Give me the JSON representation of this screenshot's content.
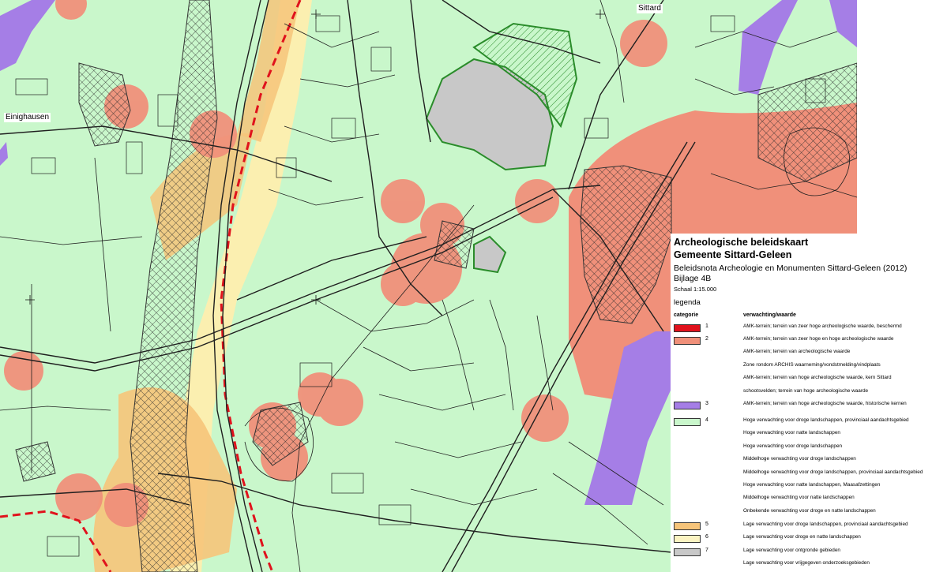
{
  "map": {
    "place_labels": [
      "Sittard",
      "Einighausen"
    ],
    "colors": {
      "green": "#c9f7cb",
      "salmon": "#f0907a",
      "purple": "#a57ee6",
      "orange": "#f6c47a",
      "yellow": "#fbefb0",
      "grey": "#c8c8c8",
      "red": "#e0121c",
      "darkgreen": "#2a8c2a",
      "road": "#1f1f1f"
    }
  },
  "legend": {
    "title1": "Archeologische beleidskaart",
    "title2": "Gemeente Sittard-Geleen",
    "subtitle": "Beleidsnota Archeologie en Monumenten Sittard-Geleen (2012)",
    "annex": "Bijlage 4B",
    "scale": "Schaal 1:15.000",
    "legend_label": "legenda",
    "col_category": "categorie",
    "col_value": "verwachting/waarde",
    "rows": [
      {
        "num": "1",
        "color": "#e0121c",
        "text": "AMK-terrein; terrein van zeer hoge archeologische waarde, beschermd"
      },
      {
        "num": "2",
        "color": "#f0907a",
        "text": "AMK-terrein; terrein van zeer hoge en hoge archeologische waarde"
      },
      {
        "num": "",
        "color": "",
        "text": "AMK-terrein; terrein van archeologische waarde"
      },
      {
        "num": "",
        "color": "",
        "text": "Zone rondom ARCHIS waarneming/vondstmelding/vindplaats"
      },
      {
        "num": "",
        "color": "",
        "text": "AMK-terrein; terrein van hoge archeologische waarde, kern Sittard"
      },
      {
        "num": "",
        "color": "",
        "text": "schootsvelden; terrein van hoge archeologische waarde"
      },
      {
        "num": "3",
        "color": "#a57ee6",
        "text": "AMK-terrein; terrein van hoge archeologische waarde, historische kernen"
      },
      {
        "num": "4",
        "color": "#c9f7cb",
        "text": "Hoge verwachting voor droge landschappen, provinciaal aandachtsgebied"
      },
      {
        "num": "",
        "color": "",
        "text": "Hoge verwachting voor natte landschappen"
      },
      {
        "num": "",
        "color": "",
        "text": "Hoge verwachting voor droge landschappen"
      },
      {
        "num": "",
        "color": "",
        "text": "Middelhoge verwachting voor droge landschappen"
      },
      {
        "num": "",
        "color": "",
        "text": "Middelhoge verwachting voor droge landschappen, provinciaal aandachtsgebied"
      },
      {
        "num": "",
        "color": "",
        "text": "Hoge verwachting voor natte landschappen, Maasafzettingen"
      },
      {
        "num": "",
        "color": "",
        "text": "Middelhoge verwachting voor natte landschappen"
      },
      {
        "num": "",
        "color": "",
        "text": "Onbekende verwachting voor droge en natte landschappen"
      },
      {
        "num": "5",
        "color": "#f6c47a",
        "text": "Lage verwachting voor droge landschappen, provinciaal aandachtsgebied"
      },
      {
        "num": "6",
        "color": "#fbf3c2",
        "text": "Lage verwachting voor droge en natte landschappen"
      },
      {
        "num": "7",
        "color": "#c8c8c8",
        "text": "Lage verwachting voor ontgronde gebieden"
      },
      {
        "num": "",
        "color": "",
        "text": "Lage verwachting voor vrijgegeven onderzoeksgebieden"
      }
    ]
  }
}
